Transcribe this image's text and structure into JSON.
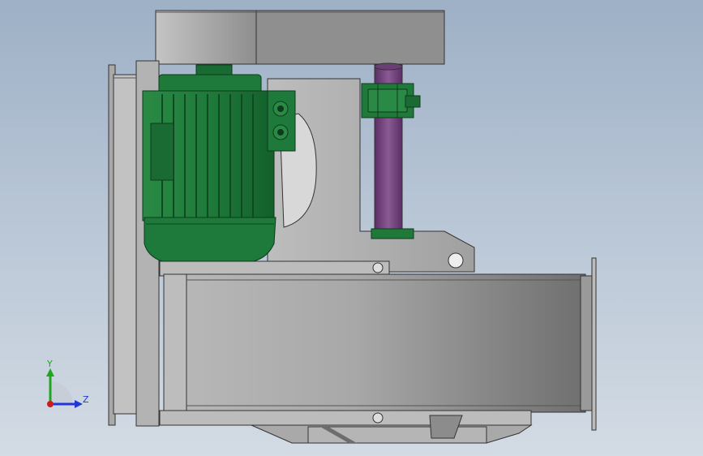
{
  "viewport": {
    "background_top": "#9eb0c6",
    "background_bottom": "#d3dbe4"
  },
  "model": {
    "parts": [
      "top-housing",
      "motor",
      "motor-terminal-box",
      "mount-bracket",
      "drive-shaft",
      "shaft-coupling",
      "fan-housing",
      "inlet-flange",
      "outlet-flange",
      "base-feet"
    ],
    "colors": {
      "motor": "#1e7a3a",
      "motor_dark": "#0f5424",
      "shaft": "#7a4a84",
      "metal_light": "#c9c9c9",
      "metal_mid": "#a3a3a3",
      "metal_dark": "#6d6d6d",
      "edge": "#333333"
    }
  },
  "triad": {
    "y_label": "Y",
    "z_label": "Z",
    "y_color": "#1fa51f",
    "z_color": "#2236d6",
    "x_color": "#d01b1b"
  }
}
